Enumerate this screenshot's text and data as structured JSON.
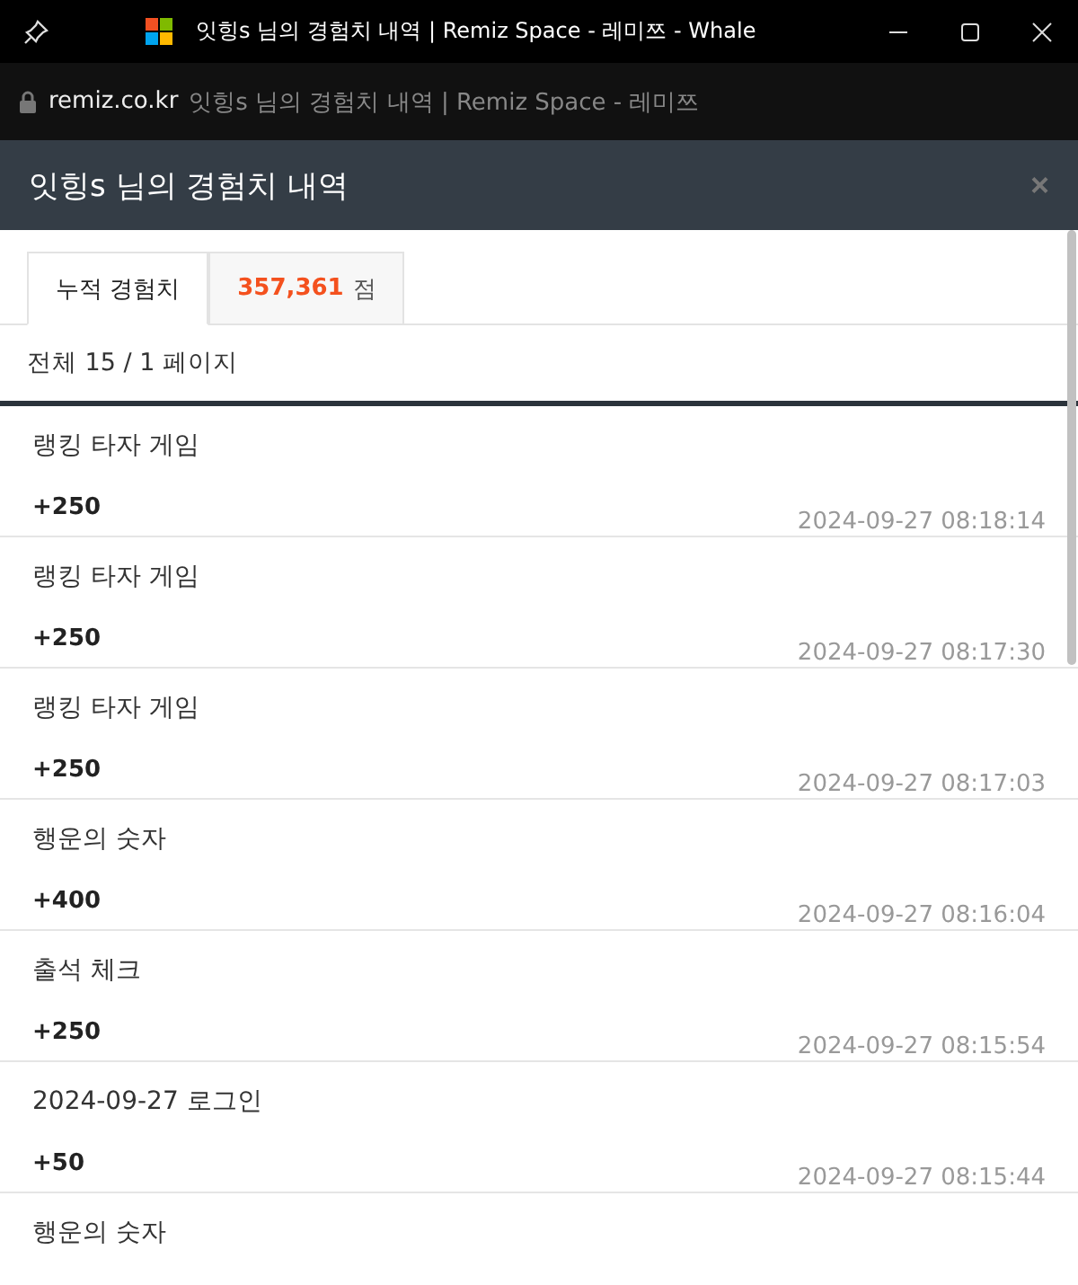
{
  "window": {
    "title": "잇힝s 님의 경험치 내역 | Remiz Space - 레미쯔 - Whale"
  },
  "address_bar": {
    "domain": "remiz.co.kr",
    "page_title": "잇힝s 님의 경험치 내역 | Remiz Space - 레미쯔"
  },
  "modal": {
    "title": "잇힝s 님의 경험치 내역",
    "close": "×"
  },
  "tabs": [
    {
      "label": "누적 경험치",
      "selected": true
    },
    {
      "value": "357,361",
      "unit": "점",
      "selected": false
    }
  ],
  "summary": "전체 15 / 1 페이지",
  "entries": [
    {
      "title": "랭킹 타자 게임",
      "points": "+250",
      "time": "2024-09-27 08:18:14"
    },
    {
      "title": "랭킹 타자 게임",
      "points": "+250",
      "time": "2024-09-27 08:17:30"
    },
    {
      "title": "랭킹 타자 게임",
      "points": "+250",
      "time": "2024-09-27 08:17:03"
    },
    {
      "title": "행운의 숫자",
      "points": "+400",
      "time": "2024-09-27 08:16:04"
    },
    {
      "title": "출석 체크",
      "points": "+250",
      "time": "2024-09-27 08:15:54"
    },
    {
      "title": "2024-09-27 로그인",
      "points": "+50",
      "time": "2024-09-27 08:15:44"
    },
    {
      "title": "행운의 숫자"
    }
  ]
}
